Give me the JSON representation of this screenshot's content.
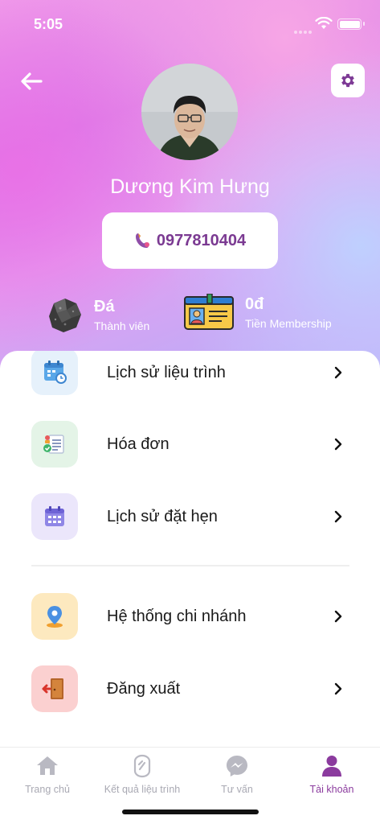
{
  "status_bar": {
    "time": "5:05"
  },
  "profile": {
    "name": "Dương Kim Hưng",
    "phone": "0977810404"
  },
  "stats": [
    {
      "value": "Đá",
      "label": "Thành viên",
      "icon": "stone-icon"
    },
    {
      "value": "0đ",
      "label": "Tiền Membership",
      "icon": "member-card-icon"
    }
  ],
  "menu": {
    "items": [
      {
        "label": "Lịch sử liệu trình",
        "icon": "calendar-clock-icon",
        "color": "#e6f1fb"
      },
      {
        "label": "Hóa đơn",
        "icon": "invoice-icon",
        "color": "#e4f4e7"
      },
      {
        "label": "Lịch sử đặt hẹn",
        "icon": "calendar-icon",
        "color": "#ebe6fb"
      },
      {
        "label": "Hệ thống chi nhánh",
        "icon": "location-pin-icon",
        "color": "#fde9bf"
      },
      {
        "label": "Đăng xuất",
        "icon": "logout-door-icon",
        "color": "#fbd0d0"
      }
    ]
  },
  "tabs": [
    {
      "label": "Trang chủ",
      "icon": "home-icon",
      "active": false
    },
    {
      "label": "Kết quả liệu trình",
      "icon": "result-shield-icon",
      "active": false
    },
    {
      "label": "Tư vấn",
      "icon": "messenger-icon",
      "active": false
    },
    {
      "label": "Tài khoản",
      "icon": "person-icon",
      "active": true
    }
  ],
  "colors": {
    "accent": "#8b3b9e",
    "phone_text": "#7b3a92",
    "inactive_tab": "#a9a9b3"
  }
}
